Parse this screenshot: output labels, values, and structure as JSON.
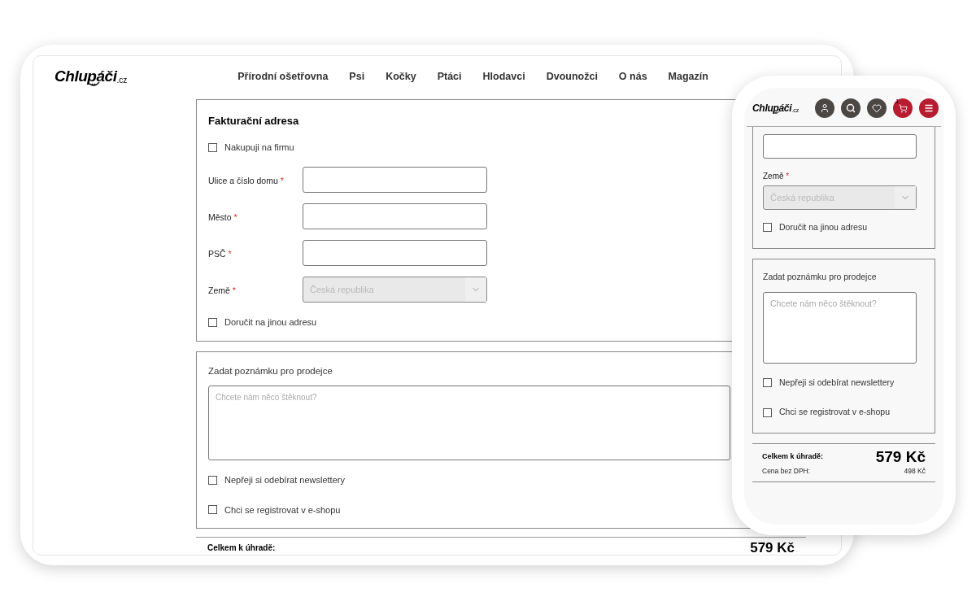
{
  "desktop": {
    "logo": {
      "name": "Chlupáči",
      "tld": ".cz"
    },
    "nav": [
      {
        "label": "Přírodní ošetřovna"
      },
      {
        "label": "Psi"
      },
      {
        "label": "Kočky"
      },
      {
        "label": "Ptáci"
      },
      {
        "label": "Hlodavci"
      },
      {
        "label": "Dvounožci"
      },
      {
        "label": "O nás"
      },
      {
        "label": "Magazín"
      }
    ],
    "billing": {
      "title": "Fakturační adresa",
      "company": {
        "label": "Nakupuji na firmu",
        "checked": false
      },
      "fields": [
        {
          "kind": "text",
          "label": "Ulice a číslo domu",
          "required_mark": "*"
        },
        {
          "kind": "text",
          "label": "Město",
          "required_mark": "*"
        },
        {
          "kind": "text",
          "label": "PSČ",
          "required_mark": "*"
        },
        {
          "kind": "select",
          "label": "Země",
          "required_mark": "*",
          "value": "Česká republika"
        }
      ],
      "delivery": {
        "label": "Doručit na jinou adresu",
        "checked": false
      }
    },
    "note": {
      "title": "Zadat poznámku pro prodejce",
      "placeholder": "Chcete nám něco štěknout?",
      "checkboxes": [
        {
          "label": "Nepřeji si odebírat newslettery",
          "checked": false
        },
        {
          "label": "Chci se registrovat v e-shopu",
          "checked": false
        }
      ]
    },
    "total": {
      "label": "Celkem k úhradě:",
      "amount": "579 Kč"
    }
  },
  "mobile": {
    "logo": {
      "name": "Chlupáči",
      "tld": ".cz"
    },
    "cart_count": "1",
    "fields": [
      {
        "kind": "text"
      },
      {
        "kind": "select",
        "label": "Země",
        "required_mark": "*",
        "value": "Česká republika"
      }
    ],
    "delivery": {
      "label": "Doručit na jinou adresu",
      "checked": false
    },
    "note": {
      "title": "Zadat poznámku pro prodejce",
      "placeholder": "Chcete nám něco štěknout?",
      "checkboxes": [
        {
          "label": "Nepřeji si odebírat newslettery",
          "checked": false
        },
        {
          "label": "Chci se registrovat v e-shopu",
          "checked": false
        }
      ]
    },
    "total": {
      "label": "Celkem k úhradě:",
      "amount": "579 Kč",
      "net_label": "Cena bez DPH:",
      "net_amount": "498 Kč"
    }
  }
}
